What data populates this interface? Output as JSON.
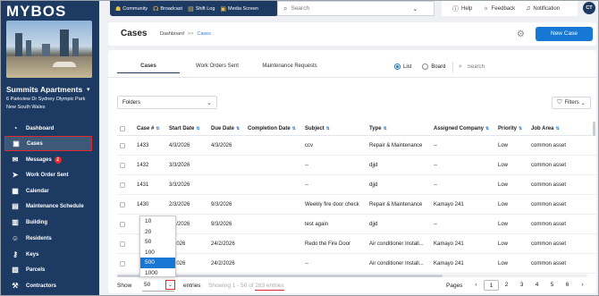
{
  "app": {
    "logo": "MYBOS"
  },
  "site": {
    "name": "Summits Apartments",
    "address": "6 Parkview Dr Sydney Olympic Park New South Wales"
  },
  "sidebar": {
    "items": [
      {
        "label": "Dashboard",
        "icon": "dashboard-icon",
        "glyph": "◔"
      },
      {
        "label": "Cases",
        "icon": "cases-icon",
        "glyph": "▣",
        "active": true
      },
      {
        "label": "Messages",
        "icon": "messages-icon",
        "glyph": "✉",
        "badge": "2"
      },
      {
        "label": "Work Order Sent",
        "icon": "send-icon",
        "glyph": "➤"
      },
      {
        "label": "Calendar",
        "icon": "calendar-icon",
        "glyph": "▦"
      },
      {
        "label": "Maintenance Schedule",
        "icon": "schedule-icon",
        "glyph": "▤"
      },
      {
        "label": "Building",
        "icon": "building-icon",
        "glyph": "▥"
      },
      {
        "label": "Residents",
        "icon": "residents-icon",
        "glyph": "☺"
      },
      {
        "label": "Keys",
        "icon": "key-icon",
        "glyph": "⚷"
      },
      {
        "label": "Parcels",
        "icon": "parcel-icon",
        "glyph": "▧"
      },
      {
        "label": "Contractors",
        "icon": "contractors-icon",
        "glyph": "⚒"
      }
    ]
  },
  "quickbar": [
    {
      "label": "Community",
      "icon": "community-icon"
    },
    {
      "label": "Broadcast",
      "icon": "broadcast-icon"
    },
    {
      "label": "Shift Log",
      "icon": "shift-log-icon"
    },
    {
      "label": "Media Screen",
      "icon": "media-screen-icon"
    }
  ],
  "top_search": {
    "placeholder": "Search"
  },
  "top_links": {
    "help": "Help",
    "feedback": "Feedback",
    "notification": "Notification",
    "avatar": "CT"
  },
  "header": {
    "title": "Cases",
    "crumb_home": "Dashboard",
    "crumb_sep": ">>",
    "crumb_current": "Cases",
    "new_case": "New Case"
  },
  "tabs": [
    "Cases",
    "Work Orders Sent",
    "Maintenance Requests"
  ],
  "view": {
    "list": "List",
    "board": "Board",
    "search_placeholder": "Search"
  },
  "folders": {
    "label": "Folders"
  },
  "filters": {
    "label": "Filters"
  },
  "table": {
    "columns": [
      "Case #",
      "Start Date",
      "Due Date",
      "Completion Date",
      "Subject",
      "Type",
      "Assigned Company",
      "Priority",
      "Job Area"
    ],
    "rows": [
      [
        "1433",
        "4/3/2026",
        "4/3/2026",
        "",
        "ccv",
        "Repair & Maintenance",
        "--",
        "Low",
        "common asset"
      ],
      [
        "1432",
        "3/3/2026",
        "",
        "",
        "--",
        "djjd",
        "--",
        "Low",
        "common asset"
      ],
      [
        "1431",
        "3/3/2026",
        "",
        "",
        "--",
        "djjd",
        "--",
        "Low",
        "common asset"
      ],
      [
        "1430",
        "2/3/2026",
        "9/3/2026",
        "",
        "Weekly fire door check",
        "Repair & Maintenance",
        "Kamayo 241",
        "Low",
        "common asset"
      ],
      [
        "",
        "2/3/2026",
        "9/3/2026",
        "",
        "test again",
        "djjd",
        "--",
        "Low",
        "common asset"
      ],
      [
        "",
        "2/2026",
        "24/2/2026",
        "",
        "Redo the Fire Door",
        "Air conditioner Install...",
        "Kamayo 241",
        "Low",
        "common asset"
      ],
      [
        "",
        "2/2026",
        "24/2/2026",
        "",
        "--",
        "Air conditioner Install...",
        "Kamayo 241",
        "Low",
        "common asset"
      ]
    ]
  },
  "footer": {
    "show": "Show",
    "show_value": "50",
    "entries": "entries",
    "info_prefix": "Showing 1 - 50 of ",
    "info_total": "283 entries",
    "pages_label": "Pages",
    "pages": [
      "1",
      "2",
      "3",
      "4",
      "5",
      "6"
    ],
    "current_page": "1"
  },
  "page_size_options": [
    "10",
    "20",
    "50",
    "100",
    "500",
    "1000"
  ],
  "page_size_highlighted": "500",
  "colors": {
    "navy": "#1d3a63",
    "accent_blue": "#1678d4",
    "highlight_red": "#e0282e"
  }
}
